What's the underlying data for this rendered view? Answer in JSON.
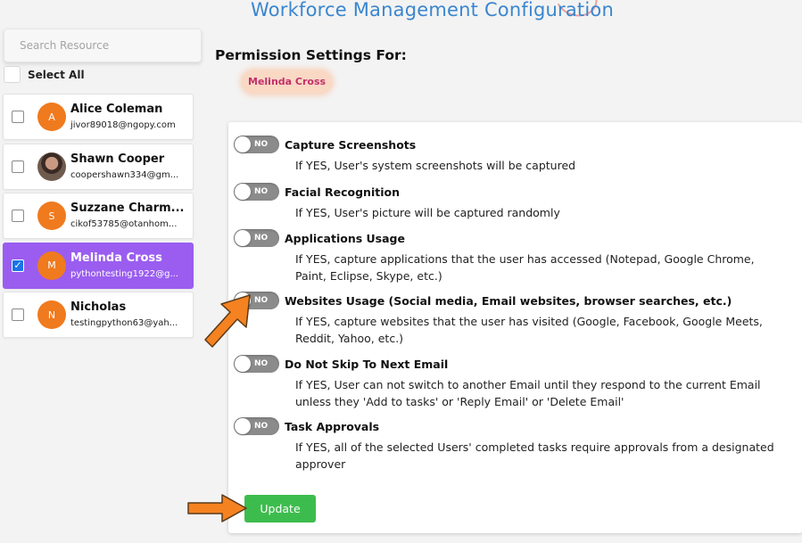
{
  "header": {
    "title": "Workforce Management Configuration"
  },
  "sidebar": {
    "search_placeholder": "Search Resource",
    "select_all_label": "Select All",
    "users": [
      {
        "initial": "A",
        "name": "Alice Coleman",
        "email": "jivor89018@ngopy.com",
        "selected": false,
        "avatar": "initial"
      },
      {
        "initial": "",
        "name": "Shawn Cooper",
        "email": "coopershawn334@gm...",
        "selected": false,
        "avatar": "photo"
      },
      {
        "initial": "S",
        "name": "Suzzane Charm...",
        "email": "cikof53785@otanhom...",
        "selected": false,
        "avatar": "initial"
      },
      {
        "initial": "M",
        "name": "Melinda Cross",
        "email": "pythontesting1922@g...",
        "selected": true,
        "avatar": "initial"
      },
      {
        "initial": "N",
        "name": "Nicholas",
        "email": "testingpython63@yah...",
        "selected": false,
        "avatar": "initial"
      }
    ]
  },
  "main": {
    "heading": "Permission Settings For:",
    "selected_user": "Melinda Cross",
    "settings": [
      {
        "toggle": "NO",
        "title": "Capture Screenshots",
        "desc": [
          "If YES, User's system screenshots will be captured"
        ]
      },
      {
        "toggle": "NO",
        "title": "Facial Recognition",
        "desc": [
          "If YES, User's picture will be captured randomly"
        ]
      },
      {
        "toggle": "NO",
        "title": "Applications Usage",
        "desc": [
          "If YES, capture applications that the user has accessed (Notepad, Google Chrome,",
          "Paint, Eclipse, Skype, etc.)"
        ]
      },
      {
        "toggle": "NO",
        "title": "Websites Usage (Social media, Email websites, browser searches, etc.)",
        "desc": [
          "If YES, capture websites that the user has visited (Google, Facebook, Google Meets,",
          "Reddit, Yahoo, etc.)"
        ]
      },
      {
        "toggle": "NO",
        "title": "Do Not Skip To Next Email",
        "desc": [
          "If YES, User can not switch to another Email until they respond to the current Email",
          "unless they 'Add to tasks' or 'Reply Email' or 'Delete Email'"
        ]
      },
      {
        "toggle": "NO",
        "title": "Task Approvals",
        "desc": [
          "If YES, all of the selected Users' completed tasks require approvals from a designated",
          "approver"
        ]
      }
    ],
    "update_label": "Update"
  },
  "colors": {
    "accent": "#3a86cf",
    "selected_card": "#9a5df0",
    "avatar": "#f07a1e",
    "update_button": "#3dbc4e",
    "annotation_arrow": "#f58220"
  }
}
